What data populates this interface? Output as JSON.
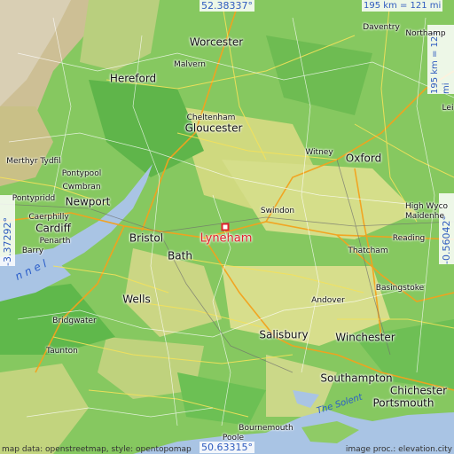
{
  "coords": {
    "top": "52.38337°",
    "bottom": "50.63315°",
    "left": "-3.37292°",
    "right": "-0.56042°"
  },
  "scale": {
    "top": "195 km = 121 mi",
    "right": "195 km = 121 mi"
  },
  "target": "Lyneham",
  "places": [
    {
      "id": "worcester",
      "name": "Worcester",
      "size": "md"
    },
    {
      "id": "malvern",
      "name": "Malvern",
      "size": "sm"
    },
    {
      "id": "hereford",
      "name": "Hereford",
      "size": "md"
    },
    {
      "id": "cheltenham",
      "name": "Cheltenham",
      "size": "sm"
    },
    {
      "id": "gloucester",
      "name": "Gloucester",
      "size": "md"
    },
    {
      "id": "witney",
      "name": "Witney",
      "size": "sm"
    },
    {
      "id": "oxford",
      "name": "Oxford",
      "size": "md"
    },
    {
      "id": "daventry",
      "name": "Daventry",
      "size": "sm"
    },
    {
      "id": "northampton",
      "name": "Northamp",
      "size": "sm"
    },
    {
      "id": "merthyr",
      "name": "Merthyr Tydfil",
      "size": "sm"
    },
    {
      "id": "pontypool",
      "name": "Pontypool",
      "size": "sm"
    },
    {
      "id": "cwmbran",
      "name": "Cwmbran",
      "size": "sm"
    },
    {
      "id": "pontypridd",
      "name": "Pontypridd",
      "size": "sm"
    },
    {
      "id": "newport",
      "name": "Newport",
      "size": "md"
    },
    {
      "id": "caerphilly",
      "name": "Caerphilly",
      "size": "sm"
    },
    {
      "id": "cardiff",
      "name": "Cardiff",
      "size": "md"
    },
    {
      "id": "penarth",
      "name": "Penarth",
      "size": "sm"
    },
    {
      "id": "barry",
      "name": "Barry",
      "size": "sm"
    },
    {
      "id": "bristol",
      "name": "Bristol",
      "size": "md"
    },
    {
      "id": "bath",
      "name": "Bath",
      "size": "md"
    },
    {
      "id": "swindon",
      "name": "Swindon",
      "size": "sm"
    },
    {
      "id": "highwycombe",
      "name": "High Wyco",
      "size": "sm"
    },
    {
      "id": "maidenhead",
      "name": "Maidenhe",
      "size": "sm"
    },
    {
      "id": "reading",
      "name": "Reading",
      "size": "sm"
    },
    {
      "id": "thatcham",
      "name": "Thatcham",
      "size": "sm"
    },
    {
      "id": "basingstoke",
      "name": "Basingstoke",
      "size": "sm"
    },
    {
      "id": "wells",
      "name": "Wells",
      "size": "md"
    },
    {
      "id": "andover",
      "name": "Andover",
      "size": "sm"
    },
    {
      "id": "bridgwater",
      "name": "Bridgwater",
      "size": "sm"
    },
    {
      "id": "taunton",
      "name": "Taunton",
      "size": "sm"
    },
    {
      "id": "salisbury",
      "name": "Salisbury",
      "size": "md"
    },
    {
      "id": "winchester",
      "name": "Winchester",
      "size": "md"
    },
    {
      "id": "southampton",
      "name": "Southampton",
      "size": "md"
    },
    {
      "id": "chichester",
      "name": "Chichester",
      "size": "md"
    },
    {
      "id": "portsmouth",
      "name": "Portsmouth",
      "size": "md"
    },
    {
      "id": "bournemouth",
      "name": "Bournemouth",
      "size": "sm"
    },
    {
      "id": "poole",
      "name": "Poole",
      "size": "sm"
    },
    {
      "id": "leic",
      "name": "Lei",
      "size": "sm"
    }
  ],
  "water": {
    "solent": "The Solent",
    "channel": "n n e l"
  },
  "credits": {
    "left": "map data: openstreetmap, style: opentopomap",
    "right": "image proc.: elevation.city"
  }
}
